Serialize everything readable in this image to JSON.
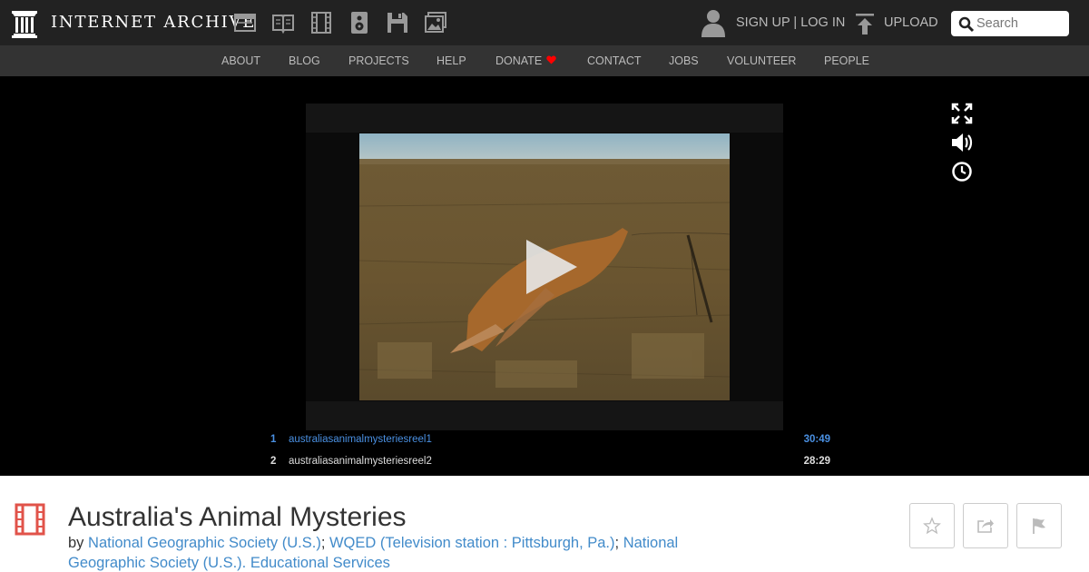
{
  "header": {
    "brand": "INTERNET ARCHIVE",
    "media_icons": [
      "web-icon",
      "texts-icon",
      "video-icon",
      "audio-icon",
      "software-icon",
      "images-icon"
    ],
    "sign_up": "SIGN UP",
    "separator": " | ",
    "log_in": "LOG IN",
    "upload": "UPLOAD",
    "search": {
      "placeholder": "Search",
      "value": ""
    }
  },
  "subnav": {
    "items": [
      "ABOUT",
      "BLOG",
      "PROJECTS",
      "HELP",
      "DONATE",
      "CONTACT",
      "JOBS",
      "VOLUNTEER",
      "PEOPLE"
    ]
  },
  "player": {
    "controls": [
      "fullscreen-icon",
      "volume-icon",
      "clock-icon"
    ],
    "playlist": [
      {
        "num": "1",
        "name": "australiasanimalmysteriesreel1",
        "duration": "30:49"
      },
      {
        "num": "2",
        "name": "australiasanimalmysteriesreel2",
        "duration": "28:29"
      }
    ]
  },
  "item": {
    "title": "Australia's Animal Mysteries",
    "by": "by",
    "creators": [
      "National Geographic Society (U.S.)",
      "WQED (Television station : Pittsburgh, Pa.)",
      "National Geographic Society (U.S.). Educational Services"
    ],
    "creator_separator": "; "
  },
  "colors": {
    "topbar": "#222222",
    "subnav": "#333333",
    "link": "#428bca",
    "active_track": "#4a90e2",
    "donate_heart": "#ff0000",
    "film_icon": "#e1534a"
  }
}
